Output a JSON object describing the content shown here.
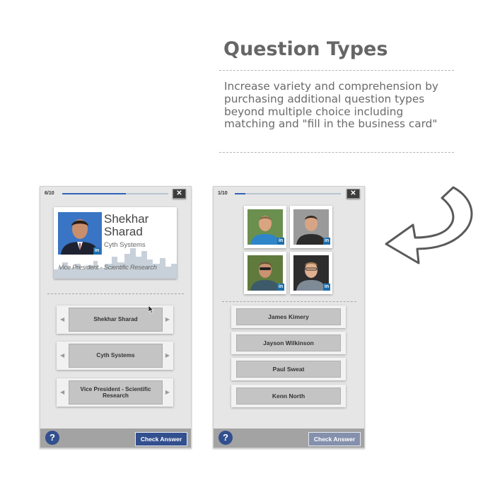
{
  "intro": {
    "title": "Question Types",
    "description": "Increase variety and comprehension by purchasing additional question types beyond multiple choice including matching and \"fill in the business card\""
  },
  "left_screen": {
    "counter": "6/10",
    "progress": 0.6,
    "close_label": "✕",
    "card": {
      "name": "Shekhar Sharad",
      "company": "Cyth Systems",
      "job_title": "Vice President - Scientific Research",
      "linkedin_badge": "in"
    },
    "answers": [
      "Shekhar Sharad",
      "Cyth Systems",
      "Vice President - Scientific Research"
    ],
    "help_label": "?",
    "check_label": "Check Answer"
  },
  "right_screen": {
    "counter": "1/10",
    "progress": 0.1,
    "close_label": "✕",
    "photo_badge": "in",
    "names": [
      "James Kimery",
      "Jayson Wilkinson",
      "Paul Sweat",
      "Kenn North"
    ],
    "help_label": "?",
    "check_label": "Check Answer"
  },
  "colors": {
    "accent": "#324f8e",
    "progress_fill": "#2f63b8",
    "heading": "#666666",
    "linkedin": "#1b6fae"
  },
  "icons": {
    "arrow": "curved-arrow-icon",
    "drag": "drag-arrow-icon",
    "help": "help-icon",
    "close": "close-icon",
    "cursor": "mouse-cursor-icon"
  }
}
